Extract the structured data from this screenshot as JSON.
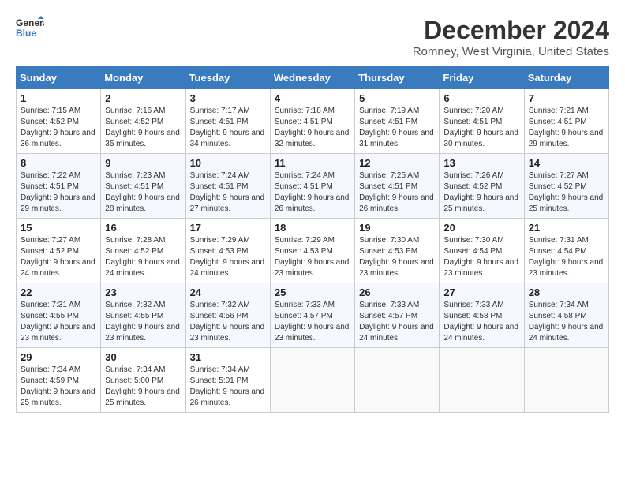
{
  "header": {
    "logo_line1": "General",
    "logo_line2": "Blue",
    "month": "December 2024",
    "location": "Romney, West Virginia, United States"
  },
  "weekdays": [
    "Sunday",
    "Monday",
    "Tuesday",
    "Wednesday",
    "Thursday",
    "Friday",
    "Saturday"
  ],
  "weeks": [
    [
      {
        "day": "1",
        "sunrise": "7:15 AM",
        "sunset": "4:52 PM",
        "daylight": "9 hours and 36 minutes."
      },
      {
        "day": "2",
        "sunrise": "7:16 AM",
        "sunset": "4:52 PM",
        "daylight": "9 hours and 35 minutes."
      },
      {
        "day": "3",
        "sunrise": "7:17 AM",
        "sunset": "4:51 PM",
        "daylight": "9 hours and 34 minutes."
      },
      {
        "day": "4",
        "sunrise": "7:18 AM",
        "sunset": "4:51 PM",
        "daylight": "9 hours and 32 minutes."
      },
      {
        "day": "5",
        "sunrise": "7:19 AM",
        "sunset": "4:51 PM",
        "daylight": "9 hours and 31 minutes."
      },
      {
        "day": "6",
        "sunrise": "7:20 AM",
        "sunset": "4:51 PM",
        "daylight": "9 hours and 30 minutes."
      },
      {
        "day": "7",
        "sunrise": "7:21 AM",
        "sunset": "4:51 PM",
        "daylight": "9 hours and 29 minutes."
      }
    ],
    [
      {
        "day": "8",
        "sunrise": "7:22 AM",
        "sunset": "4:51 PM",
        "daylight": "9 hours and 29 minutes."
      },
      {
        "day": "9",
        "sunrise": "7:23 AM",
        "sunset": "4:51 PM",
        "daylight": "9 hours and 28 minutes."
      },
      {
        "day": "10",
        "sunrise": "7:24 AM",
        "sunset": "4:51 PM",
        "daylight": "9 hours and 27 minutes."
      },
      {
        "day": "11",
        "sunrise": "7:24 AM",
        "sunset": "4:51 PM",
        "daylight": "9 hours and 26 minutes."
      },
      {
        "day": "12",
        "sunrise": "7:25 AM",
        "sunset": "4:51 PM",
        "daylight": "9 hours and 26 minutes."
      },
      {
        "day": "13",
        "sunrise": "7:26 AM",
        "sunset": "4:52 PM",
        "daylight": "9 hours and 25 minutes."
      },
      {
        "day": "14",
        "sunrise": "7:27 AM",
        "sunset": "4:52 PM",
        "daylight": "9 hours and 25 minutes."
      }
    ],
    [
      {
        "day": "15",
        "sunrise": "7:27 AM",
        "sunset": "4:52 PM",
        "daylight": "9 hours and 24 minutes."
      },
      {
        "day": "16",
        "sunrise": "7:28 AM",
        "sunset": "4:52 PM",
        "daylight": "9 hours and 24 minutes."
      },
      {
        "day": "17",
        "sunrise": "7:29 AM",
        "sunset": "4:53 PM",
        "daylight": "9 hours and 24 minutes."
      },
      {
        "day": "18",
        "sunrise": "7:29 AM",
        "sunset": "4:53 PM",
        "daylight": "9 hours and 23 minutes."
      },
      {
        "day": "19",
        "sunrise": "7:30 AM",
        "sunset": "4:53 PM",
        "daylight": "9 hours and 23 minutes."
      },
      {
        "day": "20",
        "sunrise": "7:30 AM",
        "sunset": "4:54 PM",
        "daylight": "9 hours and 23 minutes."
      },
      {
        "day": "21",
        "sunrise": "7:31 AM",
        "sunset": "4:54 PM",
        "daylight": "9 hours and 23 minutes."
      }
    ],
    [
      {
        "day": "22",
        "sunrise": "7:31 AM",
        "sunset": "4:55 PM",
        "daylight": "9 hours and 23 minutes."
      },
      {
        "day": "23",
        "sunrise": "7:32 AM",
        "sunset": "4:55 PM",
        "daylight": "9 hours and 23 minutes."
      },
      {
        "day": "24",
        "sunrise": "7:32 AM",
        "sunset": "4:56 PM",
        "daylight": "9 hours and 23 minutes."
      },
      {
        "day": "25",
        "sunrise": "7:33 AM",
        "sunset": "4:57 PM",
        "daylight": "9 hours and 23 minutes."
      },
      {
        "day": "26",
        "sunrise": "7:33 AM",
        "sunset": "4:57 PM",
        "daylight": "9 hours and 24 minutes."
      },
      {
        "day": "27",
        "sunrise": "7:33 AM",
        "sunset": "4:58 PM",
        "daylight": "9 hours and 24 minutes."
      },
      {
        "day": "28",
        "sunrise": "7:34 AM",
        "sunset": "4:58 PM",
        "daylight": "9 hours and 24 minutes."
      }
    ],
    [
      {
        "day": "29",
        "sunrise": "7:34 AM",
        "sunset": "4:59 PM",
        "daylight": "9 hours and 25 minutes."
      },
      {
        "day": "30",
        "sunrise": "7:34 AM",
        "sunset": "5:00 PM",
        "daylight": "9 hours and 25 minutes."
      },
      {
        "day": "31",
        "sunrise": "7:34 AM",
        "sunset": "5:01 PM",
        "daylight": "9 hours and 26 minutes."
      },
      null,
      null,
      null,
      null
    ]
  ]
}
